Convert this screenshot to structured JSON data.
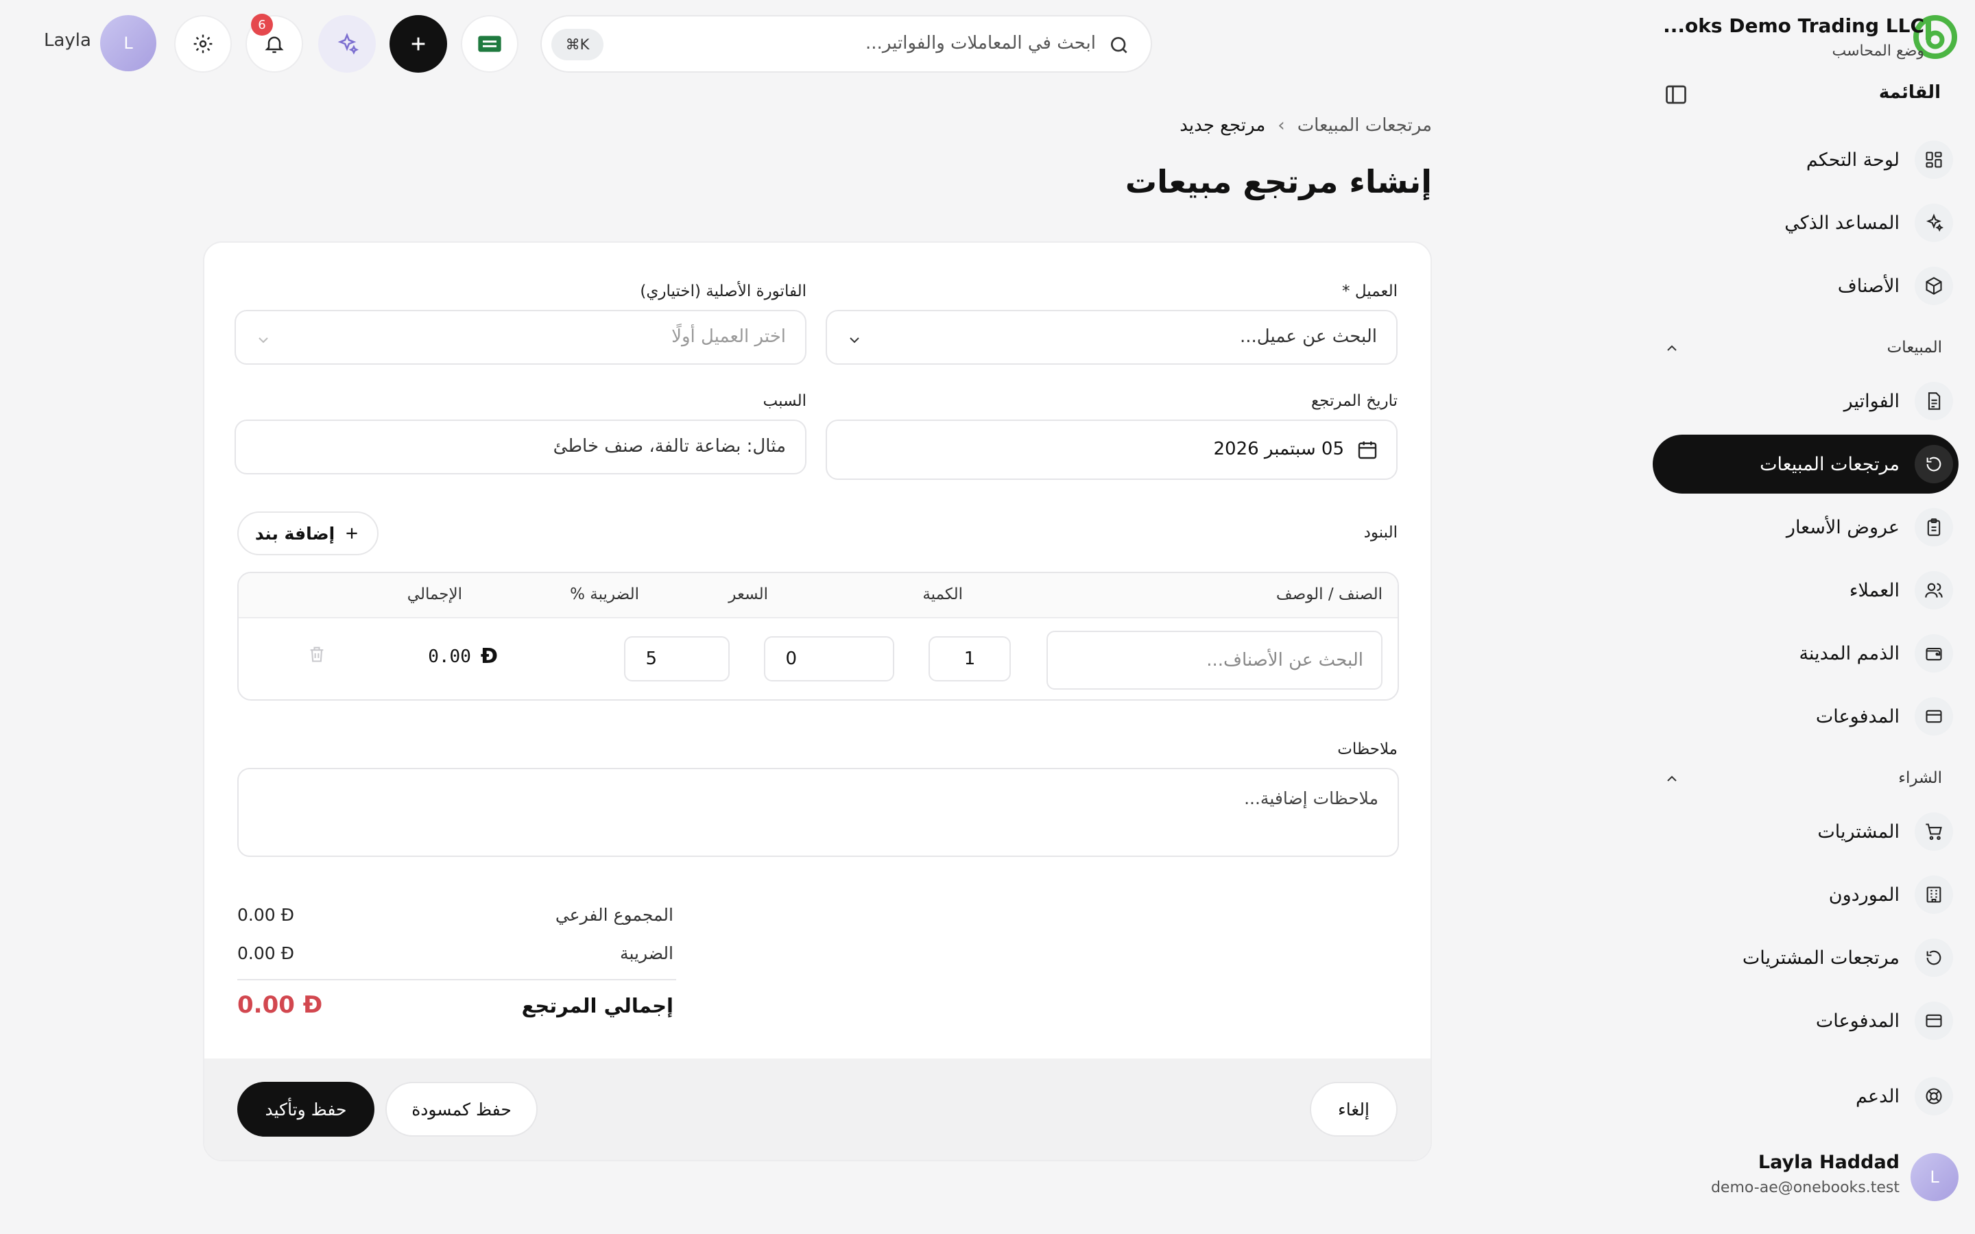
{
  "org": {
    "name": "...oks Demo Trading LLC",
    "mode": "وضع المحاسب"
  },
  "sidebar": {
    "menu_title": "القائمة",
    "sections": {
      "sales": "المبيعات",
      "purchases": "الشراء"
    },
    "items": [
      {
        "label": "لوحة التحكم",
        "icon": "dashboard-icon"
      },
      {
        "label": "المساعد الذكي",
        "icon": "sparkles-icon"
      },
      {
        "label": "الأصناف",
        "icon": "box-icon"
      },
      {
        "label": "الفواتير",
        "icon": "document-icon"
      },
      {
        "label": "مرتجعات المبيعات",
        "icon": "rotate-icon",
        "active": true
      },
      {
        "label": "عروض الأسعار",
        "icon": "clipboard-icon"
      },
      {
        "label": "العملاء",
        "icon": "users-icon"
      },
      {
        "label": "الذمم المدينة",
        "icon": "wallet-icon"
      },
      {
        "label": "المدفوعات",
        "icon": "card-icon"
      },
      {
        "label": "المشتريات",
        "icon": "cart-icon"
      },
      {
        "label": "الموردون",
        "icon": "building-icon"
      },
      {
        "label": "مرتجعات المشتريات",
        "icon": "rotate-icon"
      },
      {
        "label": "المدفوعات",
        "icon": "card-icon"
      },
      {
        "label": "الدعم",
        "icon": "lifebuoy-icon"
      }
    ],
    "user": {
      "initial": "L",
      "name": "Layla Haddad",
      "email": "demo-ae@onebooks.test"
    }
  },
  "topbar": {
    "search_placeholder": "ابحث في المعاملات والفواتير...",
    "shortcut": "⌘K",
    "notifications_count": "6",
    "user_initial": "L",
    "user_name": "Layla"
  },
  "breadcrumb": {
    "parent": "مرتجعات المبيعات",
    "separator": "›",
    "current": "مرتجع جديد"
  },
  "page_title": "إنشاء مرتجع مبيعات",
  "form": {
    "customer_label": "العميل *",
    "customer_placeholder": "البحث عن عميل...",
    "invoice_label": "الفاتورة الأصلية (اختياري)",
    "invoice_placeholder": "اختر العميل أولًا",
    "date_label": "تاريخ المرتجع",
    "date_value": "05 سبتمبر 2026",
    "reason_label": "السبب",
    "reason_placeholder": "مثال: بضاعة تالفة، صنف خاطئ",
    "items_label": "البنود",
    "add_item": "إضافة بند",
    "columns": {
      "item": "الصنف / الوصف",
      "qty": "الكمية",
      "price": "السعر",
      "tax": "الضريبة %",
      "total": "الإجمالي"
    },
    "row": {
      "item_placeholder": "البحث عن الأصناف...",
      "qty": "1",
      "price": "0",
      "tax": "5",
      "total": "0.00",
      "currency": "Đ"
    },
    "notes_label": "ملاحظات",
    "notes_placeholder": "ملاحظات إضافية..."
  },
  "summary": {
    "subtotal_label": "المجموع الفرعي",
    "subtotal": "0.00 Đ",
    "tax_label": "الضريبة",
    "tax": "0.00 Đ",
    "total_label": "إجمالي المرتجع",
    "total": "0.00 Đ"
  },
  "actions": {
    "cancel": "إلغاء",
    "save_draft": "حفظ كمسودة",
    "save_confirm": "حفظ وتأكيد"
  },
  "colors": {
    "accent": "#111111",
    "logo": "#4bb543",
    "negative_total": "#d2474f",
    "badge": "#e5484d"
  }
}
